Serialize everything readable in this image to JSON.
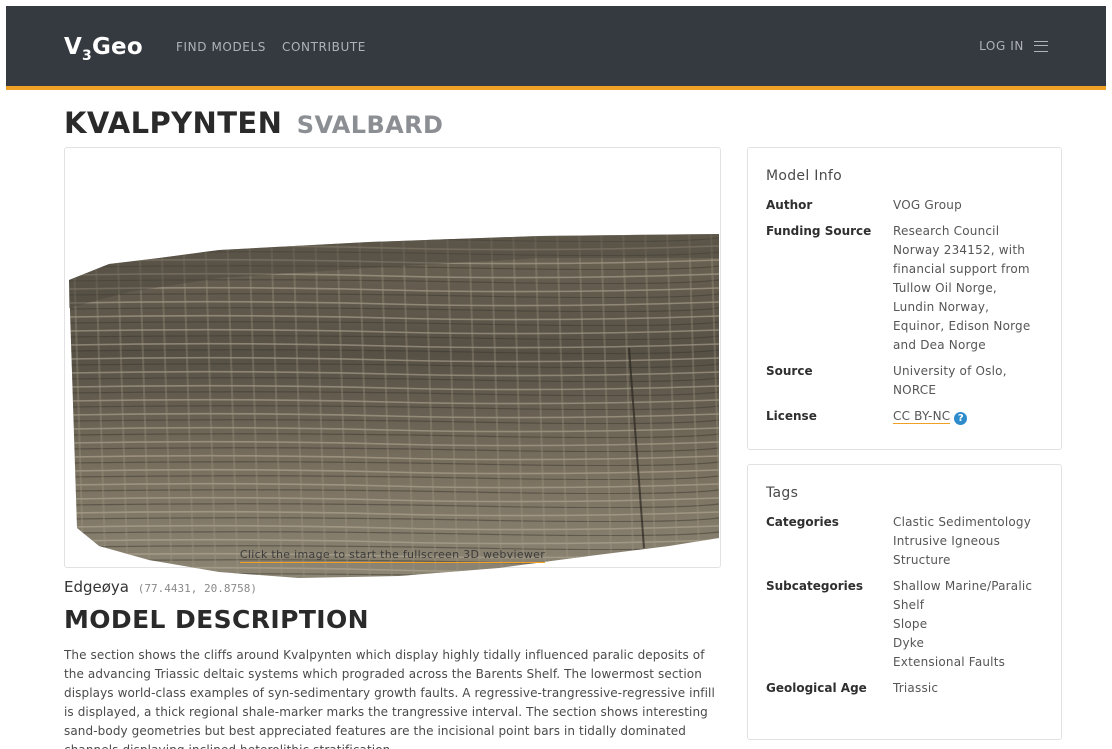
{
  "nav": {
    "brand_prefix": "V",
    "brand_sub": "3",
    "brand_suffix": "Geo",
    "links": [
      "FIND MODELS",
      "CONTRIBUTE"
    ],
    "login_label": "LOG IN",
    "menu_icon": "hamburger-icon"
  },
  "model": {
    "title": "KVALPYNTEN",
    "subtitle": "SVALBARD",
    "viewer_caption": "Click the image to start the fullscreen 3D webviewer",
    "location_name": "Edgeøya",
    "coordinates": "(77.4431, 20.8758)"
  },
  "description": {
    "heading": "MODEL DESCRIPTION",
    "text": "The section shows the cliffs around Kvalpynten which display highly tidally influenced paralic deposits of the advancing Triassic deltaic systems which prograded across the Barents Shelf. The lowermost section displays world-class examples of syn-sedimentary growth faults. A regressive-trangressive-regressive infill is displayed, a thick regional shale-marker marks the trangressive interval. The section shows interesting sand-body geometries but best appreciated features are the incisional point bars in tidally dominated channels displaying inclined heterolithic stratification."
  },
  "model_info": {
    "title": "Model Info",
    "author_label": "Author",
    "author": "VOG Group",
    "funding_label": "Funding Source",
    "funding_lines": [
      "Research Council",
      "Norway 234152, with",
      "financial support from",
      "Tullow Oil Norge,",
      "Lundin Norway,",
      "Equinor, Edison Norge",
      "and Dea Norge"
    ],
    "source_label": "Source",
    "source_lines": [
      "University of Oslo,",
      "NORCE"
    ],
    "license_label": "License",
    "license": "CC BY-NC",
    "help_icon": "question-circle-icon"
  },
  "tags": {
    "title": "Tags",
    "categories_label": "Categories",
    "categories": [
      "Clastic Sedimentology",
      "Intrusive Igneous",
      "Structure"
    ],
    "subcategories_label": "Subcategories",
    "subcategories": [
      "Shallow Marine/Paralic",
      "Shelf",
      "Slope",
      "Dyke",
      "Extensional Faults"
    ],
    "age_label": "Geological Age",
    "age": "Triassic"
  },
  "colors": {
    "navbar": "#353a40",
    "accent": "#f0a024",
    "help": "#2f8ccc"
  }
}
